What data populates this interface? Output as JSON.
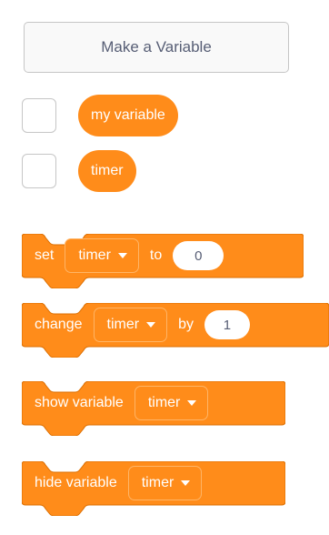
{
  "make_variable": {
    "label": "Make a Variable"
  },
  "variables": [
    {
      "name": "my variable"
    },
    {
      "name": "timer"
    }
  ],
  "blocks": {
    "set": {
      "label": "set",
      "variable": "timer",
      "joiner": "to",
      "value": "0"
    },
    "change": {
      "label": "change",
      "variable": "timer",
      "joiner": "by",
      "value": "1"
    },
    "show": {
      "label": "show variable",
      "variable": "timer"
    },
    "hide": {
      "label": "hide variable",
      "variable": "timer"
    }
  },
  "colors": {
    "block": "#ff8c1a",
    "block_border": "#db6e00",
    "field_border": "#ffb566",
    "input_text": "#575e75"
  }
}
